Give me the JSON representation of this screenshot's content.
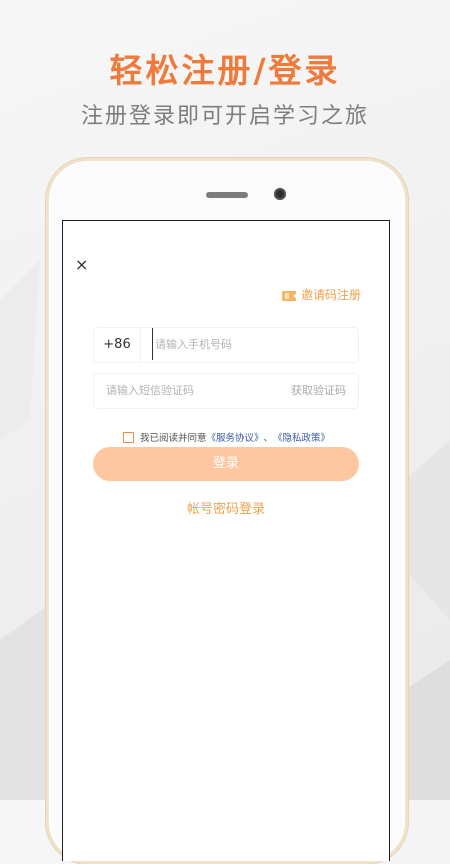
{
  "promo": {
    "headline": "轻松注册/登录",
    "subline": "注册登录即可开启学习之旅"
  },
  "login": {
    "close_icon": "×",
    "invite_label": "邀请码注册",
    "country_code": "+86",
    "phone_placeholder": "请输入手机号码",
    "code_placeholder": "请输入短信验证码",
    "get_code_label": "获取验证码",
    "agree_prefix": "我已阅读并同意",
    "service_agreement": "《服务协议》",
    "agree_separator": "、",
    "privacy_policy": "《隐私政策》",
    "login_button": "登录",
    "password_login": "帐号密码登录"
  },
  "colors": {
    "accent": "#f07a3c",
    "button_bg": "#fdc8a1",
    "link": "#3d5aa6",
    "invite": "#f0a14b"
  },
  "icons": {
    "close": "close-icon",
    "invite": "ticket-icon",
    "checkbox": "checkbox-unchecked-icon"
  }
}
